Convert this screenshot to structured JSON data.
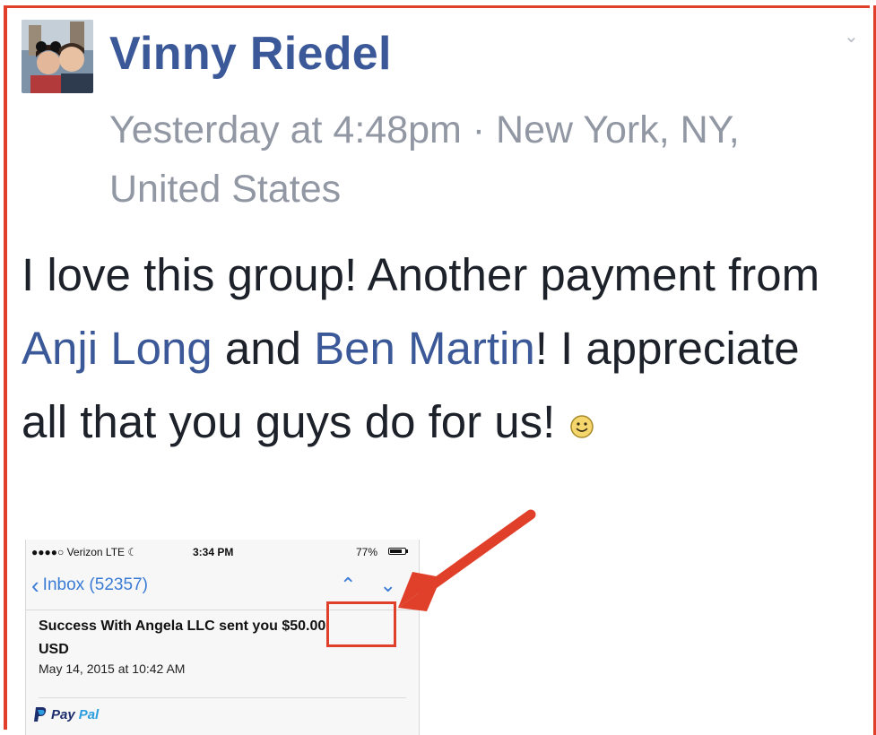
{
  "post": {
    "author": "Vinny Riedel",
    "meta": "Yesterday at 4:48pm · New York, NY, United States",
    "text_1": "I love this group! Another payment from ",
    "mention_1": "Anji Long",
    "text_2": " and ",
    "mention_2": "Ben Martin",
    "text_3": "! I appreciate all that you guys do for us!",
    "emoji": "smiley-face-icon"
  },
  "phone_screenshot": {
    "status_bar": {
      "carrier": "●●●●○ Verizon  LTE  ☾",
      "time": "3:34 PM",
      "battery": "77%"
    },
    "nav": {
      "back_label": "Inbox (52357)"
    },
    "message": {
      "subject_prefix": "Success With Angela LLC sent you ",
      "amount": "$50.00",
      "subject_suffix": "USD",
      "date": "May 14, 2015 at 10:42 AM"
    },
    "paypal_logo_pay": "Pay",
    "paypal_logo_pal": "Pal"
  },
  "colors": {
    "link_blue": "#3b5998",
    "meta_gray": "#9197a3",
    "annotation_red": "#e0402a",
    "ios_blue": "#3a7bd5"
  }
}
